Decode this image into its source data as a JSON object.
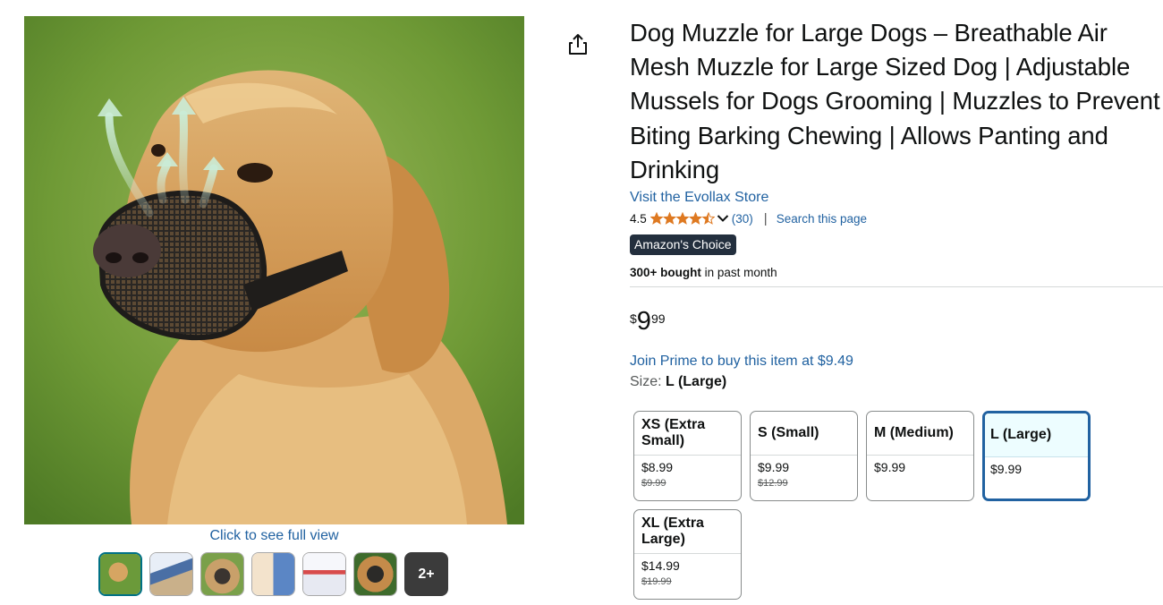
{
  "gallery": {
    "zoom_label": "Click to see full view",
    "more_label": "2+",
    "thumbnails": [
      {
        "icon": "golden-retriever-muzzle-photo"
      },
      {
        "icon": "muzzle-features-infographic"
      },
      {
        "icon": "dog-muzzle-closeup"
      },
      {
        "icon": "muzzle-use-cases-grid"
      },
      {
        "icon": "size-chart-infographic"
      },
      {
        "icon": "dog-wearing-muzzle-outdoor"
      }
    ]
  },
  "product": {
    "title": "Dog Muzzle for Large Dogs – Breathable Air Mesh Muzzle for Large Sized Dog | Adjustable Mussels for Dogs Grooming | Muzzles to Prevent Biting Barking Chewing | Allows Panting and Drinking",
    "store_link": "Visit the Evollax Store",
    "rating": "4.5",
    "rating_count": "(30)",
    "search_page": "Search this page",
    "badge": "Amazon's Choice",
    "bought_bold": "300+ bought",
    "bought_rest": " in past month",
    "price": {
      "symbol": "$",
      "whole": "9",
      "fraction": "99"
    },
    "prime_offer": "Join Prime to buy this item at $9.49",
    "size_label": "Size: ",
    "size_selected": "L (Large)"
  },
  "sizes": [
    {
      "name": "XS (Extra Small)",
      "price": "$8.99",
      "list_price": "$9.99"
    },
    {
      "name": "S (Small)",
      "price": "$9.99",
      "list_price": "$12.99"
    },
    {
      "name": "M (Medium)",
      "price": "$9.99",
      "list_price": ""
    },
    {
      "name": "L (Large)",
      "price": "$9.99",
      "list_price": "",
      "selected": true
    },
    {
      "name": "XL (Extra Large)",
      "price": "$14.99",
      "list_price": "$19.99"
    }
  ],
  "colors": {
    "link": "#2162a1",
    "star": "#de7921",
    "badge_bg": "#232f3e",
    "selected_border": "#2162a1"
  }
}
